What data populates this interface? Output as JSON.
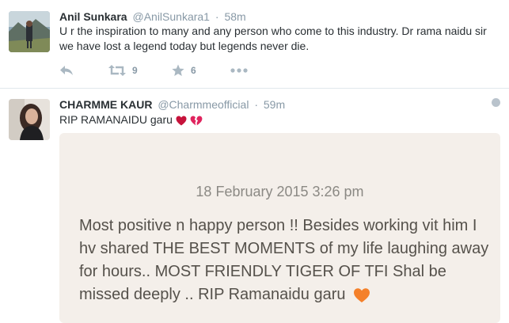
{
  "tweets": [
    {
      "name": "Anil Sunkara",
      "handle": "@AnilSunkara1",
      "dot": "·",
      "time": "58m",
      "text": "U r the inspiration to many and any person who come to this industry. Dr rama naidu sir we have lost a legend today but legends never die.",
      "retweets": "9",
      "favorites": "6"
    },
    {
      "name": "CHARMME KAUR",
      "handle": "@Charmmeofficial",
      "dot": "·",
      "time": "59m",
      "text": "RIP RAMANAIDU garu",
      "card": {
        "date": "18 February 2015 3:26 pm",
        "body": "Most positive n happy person !! Besides working vit him I hv shared THE BEST MOMENTS of my life laughing away for hours.. MOST FRIENDLY TIGER OF TFI Shal be missed deeply .. RIP Ramanaidu garu"
      }
    }
  ],
  "colors": {
    "name": "#292f33",
    "meta": "#8899a6",
    "heart_red": "#c6133b",
    "broken_heart": "#e0245e",
    "orange_heart": "#f4802a",
    "card_bg": "#f4efea"
  },
  "icons": [
    "reply-icon",
    "retweet-icon",
    "favorite-icon",
    "more-icon",
    "globe-icon"
  ]
}
